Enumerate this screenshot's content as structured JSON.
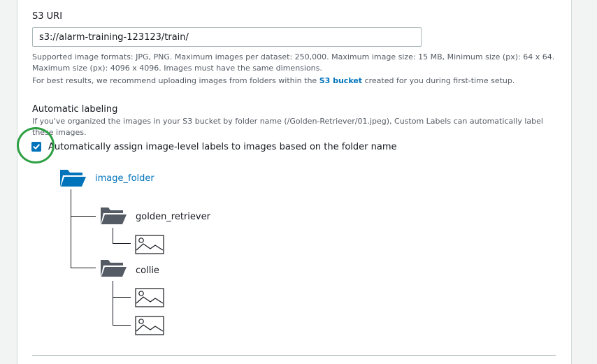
{
  "s3_uri": {
    "label": "S3 URI",
    "value": "s3://alarm-training-123123/train/",
    "formats_hint_line1": "Supported image formats: JPG, PNG. Maximum images per dataset: 250,000. Maximum image size: 15 MB, Minimum size (px): 64 x 64.",
    "formats_hint_line2": "Maximum size (px): 4096 x 4096. Images must have the same dimensions.",
    "recommend_prefix": "For best results, we recommend uploading images from folders within the ",
    "recommend_link": "S3 bucket",
    "recommend_suffix": " created for you during first-time setup."
  },
  "automatic_labeling": {
    "heading": "Automatic labeling",
    "description_line1": "If you've organized the images in your S3 bucket by folder name (/Golden-Retriever/01.jpeg), Custom Labels can automatically label",
    "description_line2": "these images.",
    "checkbox_label": "Automatically assign image-level labels to images based on the folder name",
    "checked": true
  },
  "folder_tree": {
    "root": "image_folder",
    "children": [
      {
        "name": "golden_retriever",
        "images": 1
      },
      {
        "name": "collie",
        "images": 2
      }
    ]
  },
  "colors": {
    "accent": "#0073bb",
    "folder_dark": "#545b64",
    "highlight_circle": "#2ea043"
  }
}
